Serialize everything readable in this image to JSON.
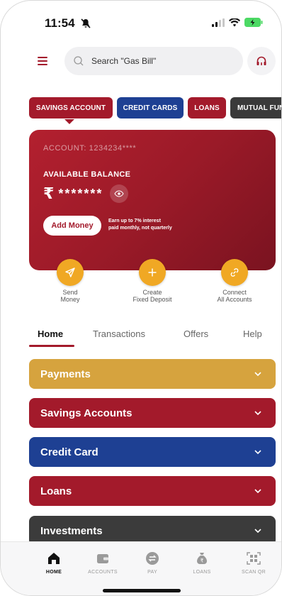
{
  "status_bar": {
    "time": "11:54"
  },
  "header": {
    "search_placeholder": "Search \"Gas Bill\""
  },
  "category_tabs": [
    {
      "label": "SAVINGS ACCOUNT"
    },
    {
      "label": "CREDIT CARDS"
    },
    {
      "label": "LOANS"
    },
    {
      "label": "MUTUAL FUN"
    }
  ],
  "account_card": {
    "account_number": "ACCOUNT: 1234234****",
    "balance_label": "AVAILABLE BALANCE",
    "currency_symbol": "₹",
    "balance_masked": "*******",
    "add_money_label": "Add Money",
    "promo_line1": "Earn up to 7% interest",
    "promo_line2": "paid monthly, not quarterly"
  },
  "quick_actions": [
    {
      "line1": "Send",
      "line2": "Money",
      "icon": "send-icon"
    },
    {
      "line1": "Create",
      "line2": "Fixed Deposit",
      "icon": "plus-icon"
    },
    {
      "line1": "Connect",
      "line2": "All Accounts",
      "icon": "link-icon"
    }
  ],
  "content_tabs": [
    {
      "label": "Home"
    },
    {
      "label": "Transactions"
    },
    {
      "label": "Offers"
    },
    {
      "label": "Help"
    }
  ],
  "sections": [
    {
      "label": "Payments"
    },
    {
      "label": "Savings Accounts"
    },
    {
      "label": "Credit Card"
    },
    {
      "label": "Loans"
    },
    {
      "label": "Investments"
    }
  ],
  "bottom_nav": [
    {
      "label": "HOME",
      "icon": "home-icon"
    },
    {
      "label": "ACCOUNTS",
      "icon": "wallet-icon"
    },
    {
      "label": "PAY",
      "icon": "transfer-icon"
    },
    {
      "label": "LOANS",
      "icon": "money-bag-icon"
    },
    {
      "label": "SCAN QR",
      "icon": "qr-scan-icon"
    }
  ],
  "colors": {
    "brand_red": "#a31a2b",
    "brand_blue": "#1e4093",
    "accent_orange": "#f0a824",
    "payments_gold": "#d6a33e",
    "dark_gray": "#3b3b3b"
  }
}
